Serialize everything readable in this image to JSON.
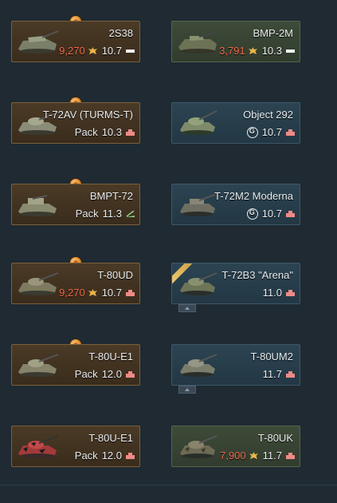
{
  "colors": {
    "background": "#1f2a33",
    "price_red": "#f06a4a",
    "premium_card": "#4a3a26",
    "research_card": "#2c4452",
    "tech_premium_card": "#3e4b38"
  },
  "vehicles": [
    {
      "name": "2S38",
      "price": "9,270",
      "br": "10.7",
      "rank_icon": "bar-icon",
      "card": "premium"
    },
    {
      "name": "BMP-2M",
      "price": "3,791",
      "br": "10.3",
      "rank_icon": "bar-icon",
      "card": "tech-premium"
    },
    {
      "name": "T-72AV (TURMS-T)",
      "pack_label": "Pack",
      "br": "10.3",
      "rank_icon": "tank-rank-icon",
      "card": "premium"
    },
    {
      "name": "Object 292",
      "br": "10.7",
      "rank_icon": "tank-rank-icon",
      "card": "research"
    },
    {
      "name": "BMPT-72",
      "pack_label": "Pack",
      "br": "11.3",
      "rank_icon": "spaa-rank-icon",
      "card": "premium"
    },
    {
      "name": "T-72M2 Moderna",
      "br": "10.7",
      "rank_icon": "tank-rank-icon",
      "card": "research"
    },
    {
      "name": "T-80UD",
      "price": "9,270",
      "br": "10.7",
      "rank_icon": "tank-rank-icon",
      "card": "premium"
    },
    {
      "name": "T-72B3 \"Arena\"",
      "br": "11.0",
      "rank_icon": "tank-rank-icon",
      "card": "research"
    },
    {
      "name": "T-80U-E1",
      "pack_label": "Pack",
      "br": "12.0",
      "rank_icon": "tank-rank-icon",
      "card": "premium"
    },
    {
      "name": "T-80UM2",
      "br": "11.7",
      "rank_icon": "tank-rank-icon",
      "card": "research"
    },
    {
      "name": "T-80U-E1",
      "pack_label": "Pack",
      "br": "12.0",
      "rank_icon": "tank-rank-icon",
      "card": "premium"
    },
    {
      "name": "T-80UK",
      "price": "7,900",
      "br": "11.7",
      "rank_icon": "tank-rank-icon",
      "card": "tech-premium"
    }
  ]
}
